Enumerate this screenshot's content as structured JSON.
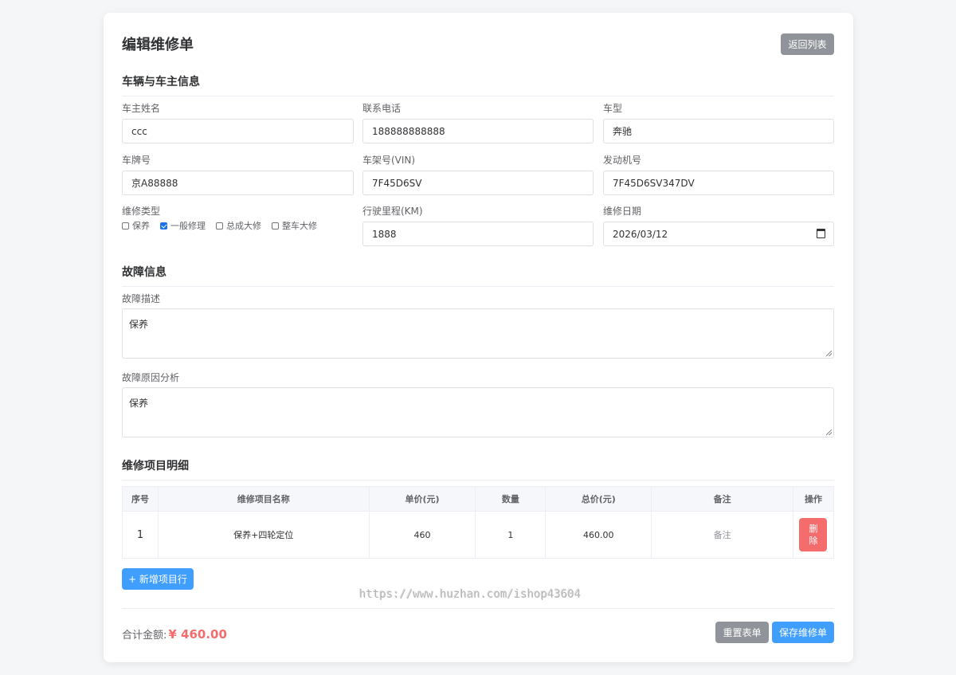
{
  "header": {
    "title": "编辑维修单",
    "back_label": "返回列表"
  },
  "vehicle_section": {
    "title": "车辆与车主信息",
    "owner_name": {
      "label": "车主姓名",
      "value": "ccc"
    },
    "phone": {
      "label": "联系电话",
      "value": "188888888888"
    },
    "model": {
      "label": "车型",
      "value": "奔驰"
    },
    "plate": {
      "label": "车牌号",
      "value": "京A88888"
    },
    "vin": {
      "label": "车架号(VIN)",
      "value": "7F45D6SV"
    },
    "engine": {
      "label": "发动机号",
      "value": "7F45D6SV347DV"
    },
    "repair_type": {
      "label": "维修类型",
      "options": [
        {
          "label": "保养",
          "checked": false
        },
        {
          "label": "一般修理",
          "checked": true
        },
        {
          "label": "总成大修",
          "checked": false
        },
        {
          "label": "整车大修",
          "checked": false
        }
      ]
    },
    "mileage": {
      "label": "行驶里程(KM)",
      "value": "1888"
    },
    "repair_date": {
      "label": "维修日期",
      "value": "2026/03/12"
    }
  },
  "fault_section": {
    "title": "故障信息",
    "description": {
      "label": "故障描述",
      "value": "保养"
    },
    "cause": {
      "label": "故障原因分析",
      "value": "保养"
    }
  },
  "items_section": {
    "title": "维修项目明细",
    "columns": [
      "序号",
      "维修项目名称",
      "单价(元)",
      "数量",
      "总价(元)",
      "备注",
      "操作"
    ],
    "rows": [
      {
        "index": "1",
        "name": "保养+四轮定位",
        "price": "460",
        "qty": "1",
        "total": "460.00",
        "remark": "备注",
        "delete_label": "删除"
      }
    ],
    "add_row_label": "+ 新增项目行"
  },
  "footer": {
    "total_label": "合计金额:",
    "total_value": "¥ 460.00",
    "reset_label": "重置表单",
    "save_label": "保存维修单"
  },
  "watermark": "https://www.huzhan.com/ishop43604",
  "colors": {
    "primary": "#409eff",
    "gray_button": "#909399",
    "danger": "#f56c6c"
  }
}
